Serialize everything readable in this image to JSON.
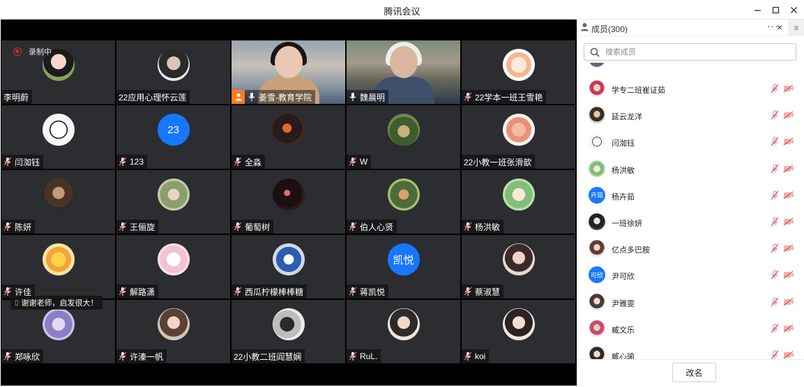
{
  "window": {
    "title": "腾讯会议",
    "controls": [
      "minimize-icon",
      "maximize-icon",
      "close-icon"
    ]
  },
  "recording": {
    "label": "录制中"
  },
  "chat_bubble": {
    "text": "谢谢老师，启发很大！"
  },
  "tiles": [
    {
      "name": "李明蔚",
      "avatar": "photo",
      "mic": "none"
    },
    {
      "name": "22应用心理怀云莲",
      "avatar": "photo",
      "mic": "none"
    },
    {
      "name": "姜雪-教育学院",
      "avatar": "video",
      "mic": "on",
      "host": true
    },
    {
      "name": "魏晨明",
      "avatar": "video",
      "mic": "on",
      "speaking": true
    },
    {
      "name": "22学本一班王雪艳",
      "avatar": "photo",
      "mic": "muted"
    },
    {
      "name": "闫洳钰",
      "avatar": "photo",
      "mic": "muted"
    },
    {
      "name": "123",
      "avatar": "initials",
      "initials": "23",
      "mic": "muted"
    },
    {
      "name": "全淼",
      "avatar": "photo",
      "mic": "muted"
    },
    {
      "name": "W",
      "avatar": "photo",
      "mic": "muted"
    },
    {
      "name": "22小教一班张滑歆",
      "avatar": "photo",
      "mic": "none"
    },
    {
      "name": "陈妍",
      "avatar": "photo",
      "mic": "muted"
    },
    {
      "name": "王俪旋",
      "avatar": "photo",
      "mic": "muted"
    },
    {
      "name": "葡萄树",
      "avatar": "photo",
      "mic": "muted"
    },
    {
      "name": "伯人心贤",
      "avatar": "photo",
      "mic": "muted"
    },
    {
      "name": "杨洪敏",
      "avatar": "photo",
      "mic": "muted"
    },
    {
      "name": "许佳",
      "avatar": "photo",
      "mic": "muted"
    },
    {
      "name": "解路潇",
      "avatar": "photo",
      "mic": "muted"
    },
    {
      "name": "西瓜柠檬棒棒糖",
      "avatar": "photo",
      "mic": "muted"
    },
    {
      "name": "蒋凯悦",
      "avatar": "initials",
      "initials": "凯悦",
      "mic": "muted"
    },
    {
      "name": "蔡淑慧",
      "avatar": "photo",
      "mic": "muted"
    },
    {
      "name": "郑咏欣",
      "avatar": "photo",
      "mic": "muted"
    },
    {
      "name": "许溱一帆",
      "avatar": "photo",
      "mic": "muted"
    },
    {
      "name": "22小教二班阎慧娴",
      "avatar": "photo",
      "mic": "none"
    },
    {
      "name": "RuL.",
      "avatar": "photo",
      "mic": "muted"
    },
    {
      "name": "koi",
      "avatar": "photo",
      "mic": "muted"
    }
  ],
  "panel": {
    "title": "成员(300)",
    "more_label": "···",
    "close_label": "×",
    "menu_label": "≡",
    "search_placeholder": "搜索成员",
    "rename_label": "改名"
  },
  "members": [
    {
      "name": "学专二班崔证茹",
      "avatar": "photo"
    },
    {
      "name": "延云龙洋",
      "avatar": "photo"
    },
    {
      "name": "闫洳钰",
      "avatar": "photo"
    },
    {
      "name": "杨洪敏",
      "avatar": "photo"
    },
    {
      "name": "杨卉茹",
      "avatar": "initials",
      "initials": "卉茹"
    },
    {
      "name": "一班徐妍",
      "avatar": "photo"
    },
    {
      "name": "亿点多巴胺",
      "avatar": "photo"
    },
    {
      "name": "尹可欣",
      "avatar": "initials",
      "initials": "可欣"
    },
    {
      "name": "尹雅雯",
      "avatar": "photo"
    },
    {
      "name": "臧文乐",
      "avatar": "photo"
    },
    {
      "name": "臧心瑜",
      "avatar": "photo"
    }
  ],
  "colors": {
    "accent": "#1677ff",
    "speaking": "#37c36a",
    "host": "#ff7a1a",
    "muted": "#e05252",
    "tile_bg": "#2b2d31"
  }
}
